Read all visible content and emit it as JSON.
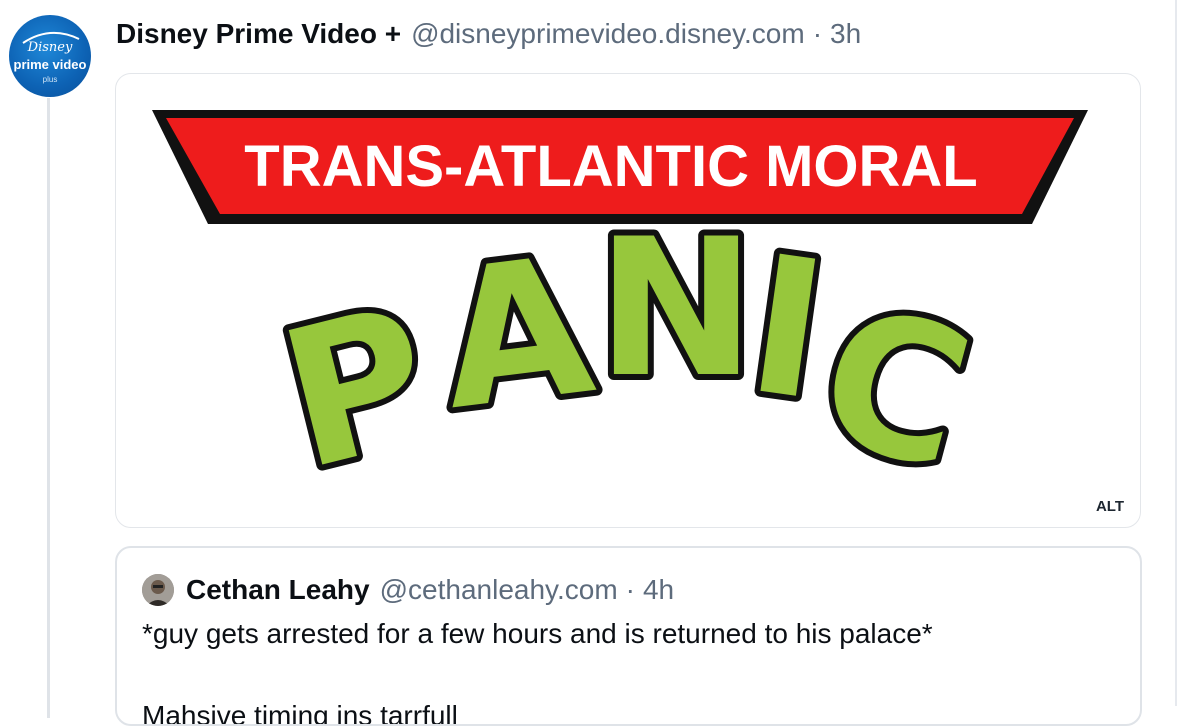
{
  "post": {
    "author": {
      "display_name": "Disney Prime Video +",
      "handle": "@disneyprimevideo.disney.com",
      "avatar_text": {
        "brand": "Disney",
        "product": "prime video",
        "suffix": "plus"
      }
    },
    "time_separator": "·",
    "time": "3h",
    "image": {
      "banner_text": "TRANS-ATLANTIC MORAL",
      "headline_letters": [
        "P",
        "A",
        "N",
        "I",
        "C"
      ],
      "alt_label": "ALT",
      "colors": {
        "banner_red": "#ee1c1c",
        "letter_green": "#97c73c",
        "outline": "#111111"
      }
    }
  },
  "quote": {
    "author": {
      "display_name": "Cethan Leahy",
      "handle": "@cethanleahy.com"
    },
    "time_separator": "·",
    "time": "4h",
    "text": "*guy gets arrested for a few hours and is returned to his palace*",
    "text_line_2": "Mahsive timing ins tarrfull"
  }
}
